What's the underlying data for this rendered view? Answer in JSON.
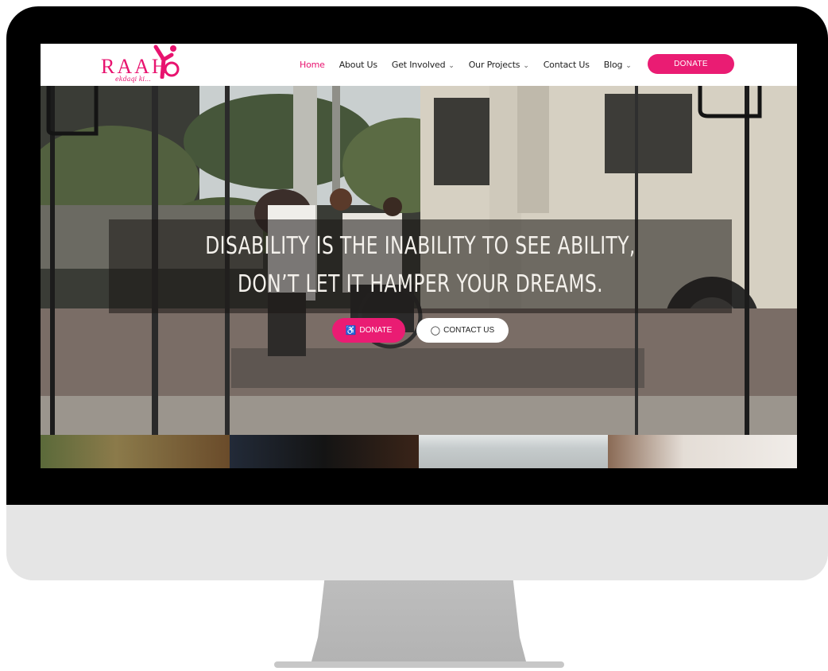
{
  "site": {
    "logo_text": "RAAH",
    "logo_tagline": "ekdaqi ki...",
    "brand_color": "#ea1c73"
  },
  "nav": {
    "items": [
      {
        "label": "Home",
        "active": true,
        "dropdown": false
      },
      {
        "label": "About Us",
        "active": false,
        "dropdown": false
      },
      {
        "label": "Get Involved",
        "active": false,
        "dropdown": true
      },
      {
        "label": "Our Projects",
        "active": false,
        "dropdown": true
      },
      {
        "label": "Contact Us",
        "active": false,
        "dropdown": false
      },
      {
        "label": "Blog",
        "active": false,
        "dropdown": true
      }
    ],
    "donate_label": "DONATE"
  },
  "hero": {
    "quote": "Disability is the inability to see ability, don’t let it hamper your dreams.",
    "donate_label": "DONATE",
    "donate_icon": "wheelchair-icon",
    "contact_label": "CONTACT US",
    "contact_icon": "chat-bubble-icon"
  },
  "icons": {
    "chevron": "chevron-down-icon"
  }
}
